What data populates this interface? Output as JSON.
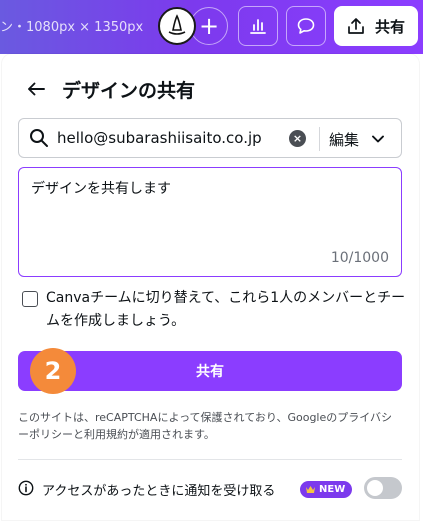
{
  "topbar": {
    "canvas_size": "ン・1080px × 1350px",
    "share_label": "共有"
  },
  "panel": {
    "title": "デザインの共有",
    "search": {
      "value": "hello@subarashiisaito.co.jp",
      "permission": "編集"
    },
    "message": {
      "value": "デザインを共有します",
      "count": "10/1000"
    },
    "team_checkbox_label": "Canvaチームに切り替えて、これら1人のメンバーとチームを作成しましょう。",
    "share_button_label": "共有",
    "step_marker": "2",
    "recaptcha_text": "このサイトは、reCAPTCHAによって保護されており、Googleのプライバシーポリシーと利用規約が適用されます。",
    "notify": {
      "label": "アクセスがあったときに通知を受け取る",
      "badge": "NEW",
      "enabled": false
    }
  },
  "colors": {
    "brand_purple": "#8b3dff",
    "step_orange": "#f48a3a"
  }
}
